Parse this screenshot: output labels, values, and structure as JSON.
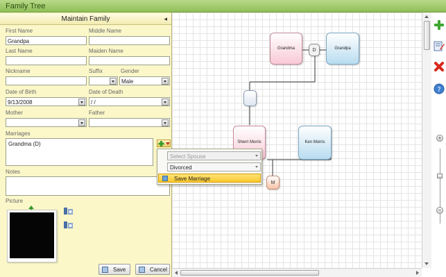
{
  "window": {
    "title": "Family Tree"
  },
  "panel": {
    "title": "Maintain Family",
    "labels": {
      "first_name": "First Name",
      "middle_name": "Middle Name",
      "last_name": "Last Name",
      "maiden_name": "Maiden Name",
      "nickname": "Nickname",
      "suffix": "Suffix",
      "gender": "Gender",
      "date_of_birth": "Date of Birth",
      "date_of_death": "Date of Death",
      "mother": "Mother",
      "father": "Father",
      "marriages": "Marriages",
      "notes": "Notes",
      "picture": "Picture"
    },
    "values": {
      "first_name": "Grandpa",
      "middle_name": "",
      "last_name": "",
      "maiden_name": "",
      "nickname": "",
      "suffix": "",
      "gender": "Male",
      "date_of_birth": "9/13/2008",
      "date_of_death": "/ /",
      "mother": "",
      "father": "",
      "marriages": "Grandma  (D)",
      "notes": ""
    },
    "marriage_menu": {
      "spouse_placeholder": "Select Spouse",
      "status": "Divorced",
      "save_label": "Save Marriage"
    },
    "buttons": {
      "save": "Save",
      "cancel": "Cancel"
    }
  },
  "tree": {
    "nodes": {
      "grandma": "Grandma",
      "grandpa": "Grandpa",
      "divorced_marker": "D",
      "sherri": "Sherri Morris",
      "ken": "Ken Morris",
      "married_marker": "M"
    }
  },
  "toolbar": {
    "icons": [
      "add-icon",
      "edit-icon",
      "delete-icon",
      "help-icon"
    ],
    "zoom": [
      "zoom-in-icon",
      "zoom-out-icon"
    ]
  },
  "colors": {
    "titlebar": "#9bc965",
    "panel_bg": "#fbf7c9",
    "female_node": "#f8c9d6",
    "male_node": "#b8dcf0",
    "highlight": "#f9c82c"
  }
}
